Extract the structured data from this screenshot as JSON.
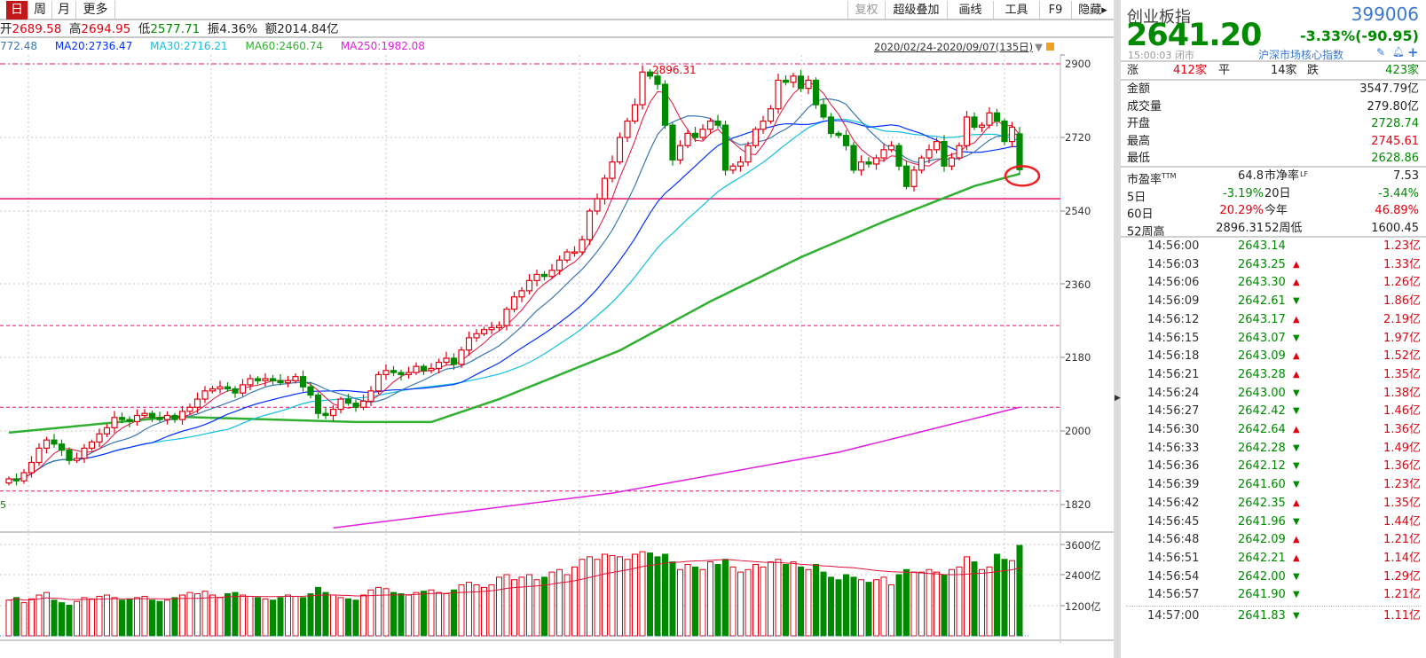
{
  "toolbar": {
    "tabs": [
      {
        "label": "日",
        "active": true
      },
      {
        "label": "周"
      },
      {
        "label": "月"
      },
      {
        "label": "更多"
      }
    ],
    "buttons": [
      "复权",
      "超级叠加",
      "画线",
      "工具",
      "F9",
      "隐藏▸"
    ]
  },
  "info": {
    "open_label": "开",
    "open": "2689.58",
    "high_label": "高",
    "high": "2694.95",
    "low_label": "低",
    "low": "2577.71",
    "amp_label": "振",
    "amp": "4.36%",
    "amount_label": "额",
    "amount": "2014.84亿"
  },
  "ma_legend": [
    {
      "text": "772.48",
      "color": "#3a78b0"
    },
    {
      "text": "MA20:2736.47",
      "color": "#0030ff"
    },
    {
      "text": "MA30:2716.21",
      "color": "#10c0e0"
    },
    {
      "text": "MA60:2460.74",
      "color": "#30b030"
    },
    {
      "text": "MA250:1982.08",
      "color": "#e020e0"
    }
  ],
  "date_range": "2020/02/24-2020/09/07(135日)",
  "left_edge_label": "5",
  "chart_data": {
    "type": "candlestick",
    "price_axis": {
      "ticks": [
        "2900",
        "2720",
        "2540",
        "2360",
        "2180",
        "2000",
        "1820"
      ],
      "range": [
        1770,
        2920
      ]
    },
    "volume_axis": {
      "ticks": [
        "3600亿",
        "2400亿",
        "1200亿"
      ],
      "range": [
        0,
        4000
      ]
    },
    "max_annotation": "2896.31",
    "closes": [
      1885,
      1880,
      1900,
      1925,
      1960,
      1980,
      1970,
      1955,
      1930,
      1935,
      1960,
      1975,
      1995,
      2010,
      2035,
      2030,
      2025,
      2040,
      2045,
      2035,
      2030,
      2040,
      2030,
      2050,
      2060,
      2080,
      2100,
      2105,
      2110,
      2105,
      2095,
      2115,
      2130,
      2125,
      2130,
      2125,
      2120,
      2125,
      2135,
      2110,
      2090,
      2045,
      2040,
      2055,
      2080,
      2070,
      2060,
      2075,
      2100,
      2140,
      2150,
      2145,
      2140,
      2145,
      2160,
      2150,
      2155,
      2170,
      2180,
      2165,
      2200,
      2230,
      2240,
      2250,
      2255,
      2260,
      2300,
      2330,
      2345,
      2370,
      2385,
      2380,
      2395,
      2420,
      2440,
      2440,
      2470,
      2540,
      2570,
      2620,
      2660,
      2720,
      2760,
      2800,
      2880,
      2870,
      2850,
      2750,
      2665,
      2700,
      2730,
      2720,
      2740,
      2760,
      2750,
      2640,
      2650,
      2660,
      2700,
      2740,
      2760,
      2790,
      2860,
      2855,
      2870,
      2840,
      2860,
      2800,
      2770,
      2730,
      2725,
      2700,
      2640,
      2660,
      2655,
      2670,
      2690,
      2700,
      2650,
      2600,
      2640,
      2670,
      2690,
      2710,
      2650,
      2670,
      2700,
      2770,
      2745,
      2750,
      2780,
      2760,
      2710,
      2745,
      2641.2
    ],
    "last_candle": {
      "open": 2728.74,
      "high": 2745.61,
      "low": 2628.86,
      "close": 2641.2
    },
    "volumes": [
      1400,
      1500,
      1300,
      1450,
      1600,
      1700,
      1400,
      1300,
      1200,
      1350,
      1500,
      1450,
      1550,
      1600,
      1500,
      1400,
      1450,
      1500,
      1550,
      1400,
      1350,
      1400,
      1500,
      1600,
      1700,
      1650,
      1750,
      1600,
      1500,
      1650,
      1700,
      1600,
      1550,
      1500,
      1450,
      1400,
      1500,
      1600,
      1550,
      1500,
      1650,
      1900,
      1700,
      1600,
      1500,
      1450,
      1400,
      1600,
      1800,
      1900,
      1850,
      1700,
      1650,
      1600,
      1700,
      1750,
      1800,
      1700,
      1650,
      1800,
      2000,
      2100,
      2000,
      1900,
      2000,
      2300,
      2400,
      2200,
      2300,
      2400,
      2200,
      2300,
      2500,
      2600,
      2400,
      2700,
      3000,
      3100,
      3000,
      3200,
      3150,
      3100,
      3000,
      3200,
      3300,
      3250,
      3100,
      3200,
      2900,
      2600,
      2800,
      2700,
      2600,
      2900,
      2800,
      3000,
      2700,
      2500,
      2600,
      2800,
      2700,
      2900,
      3000,
      2800,
      2900,
      2700,
      2600,
      2800,
      2500,
      2300,
      2200,
      2400,
      2300,
      2200,
      2100,
      2200,
      2300,
      2000,
      2400,
      2600,
      2500,
      2500,
      2600,
      2500,
      2400,
      2600,
      2700,
      3100,
      2900,
      2600,
      2700,
      3200,
      3000,
      2950,
      3547
    ],
    "ma60_path": [
      [
        0,
        1998
      ],
      [
        22,
        2037
      ],
      [
        46,
        2024
      ],
      [
        56,
        2024
      ],
      [
        65,
        2080
      ],
      [
        81,
        2199
      ],
      [
        93,
        2319
      ],
      [
        105,
        2427
      ],
      [
        116,
        2514
      ],
      [
        128,
        2601
      ],
      [
        134,
        2631
      ]
    ],
    "ma250_path": [
      [
        43,
        1765
      ],
      [
        80,
        1850
      ],
      [
        110,
        1950
      ],
      [
        134,
        2060
      ]
    ],
    "ref_lines": {
      "solid": 2570,
      "dashed": [
        2900,
        2260,
        2060,
        1855
      ]
    }
  },
  "quote": {
    "name": "创业板指",
    "code": "399006",
    "price": "2641.20",
    "change": "-3.33%(-90.95)",
    "time": "15:00:03",
    "status": "闭市",
    "category": "沪深市场核心指数",
    "breadth": {
      "up_label": "涨",
      "up": "412家",
      "flat_label": "平",
      "flat": "14家",
      "down_label": "跌",
      "down": "423家"
    },
    "stats": [
      {
        "label": "金额",
        "value": "3547.79亿",
        "cls": ""
      },
      {
        "label": "成交量",
        "value": "279.80亿",
        "cls": ""
      },
      {
        "label": "开盘",
        "value": "2728.74",
        "cls": "grn"
      },
      {
        "label": "最高",
        "value": "2745.61",
        "cls": "red"
      },
      {
        "label": "最低",
        "value": "2628.86",
        "cls": "grn"
      }
    ],
    "ratios": [
      {
        "l1": "市盈率",
        "s1": "TTM",
        "v1": "64.8",
        "c1": "",
        "l2": "市净率",
        "s2": "LF",
        "v2": "7.53",
        "c2": ""
      },
      {
        "l1": "5日",
        "s1": "",
        "v1": "-3.19%",
        "c1": "grn",
        "l2": "20日",
        "s2": "",
        "v2": "-3.44%",
        "c2": "grn"
      },
      {
        "l1": "60日",
        "s1": "",
        "v1": "20.29%",
        "c1": "red",
        "l2": "今年",
        "s2": "",
        "v2": "46.89%",
        "c2": "red"
      },
      {
        "l1": "52周高",
        "s1": "",
        "v1": "2896.31",
        "c1": "",
        "l2": "52周低",
        "s2": "",
        "v2": "1600.45",
        "c2": ""
      }
    ]
  },
  "ticks": [
    {
      "time": "14:56:00",
      "price": "2643.14",
      "dir": "",
      "vol": "1.23亿"
    },
    {
      "time": "14:56:03",
      "price": "2643.25",
      "dir": "up",
      "vol": "1.33亿"
    },
    {
      "time": "14:56:06",
      "price": "2643.30",
      "dir": "up",
      "vol": "1.26亿"
    },
    {
      "time": "14:56:09",
      "price": "2642.61",
      "dir": "down",
      "vol": "1.86亿"
    },
    {
      "time": "14:56:12",
      "price": "2643.17",
      "dir": "up",
      "vol": "2.19亿"
    },
    {
      "time": "14:56:15",
      "price": "2643.07",
      "dir": "down",
      "vol": "1.97亿"
    },
    {
      "time": "14:56:18",
      "price": "2643.09",
      "dir": "up",
      "vol": "1.52亿"
    },
    {
      "time": "14:56:21",
      "price": "2643.28",
      "dir": "up",
      "vol": "1.35亿"
    },
    {
      "time": "14:56:24",
      "price": "2643.00",
      "dir": "down",
      "vol": "1.38亿"
    },
    {
      "time": "14:56:27",
      "price": "2642.42",
      "dir": "down",
      "vol": "1.46亿"
    },
    {
      "time": "14:56:30",
      "price": "2642.64",
      "dir": "up",
      "vol": "1.36亿"
    },
    {
      "time": "14:56:33",
      "price": "2642.28",
      "dir": "down",
      "vol": "1.49亿"
    },
    {
      "time": "14:56:36",
      "price": "2642.12",
      "dir": "down",
      "vol": "1.36亿"
    },
    {
      "time": "14:56:39",
      "price": "2641.60",
      "dir": "down",
      "vol": "1.23亿"
    },
    {
      "time": "14:56:42",
      "price": "2642.35",
      "dir": "up",
      "vol": "1.35亿"
    },
    {
      "time": "14:56:45",
      "price": "2641.96",
      "dir": "down",
      "vol": "1.44亿"
    },
    {
      "time": "14:56:48",
      "price": "2642.09",
      "dir": "up",
      "vol": "1.21亿"
    },
    {
      "time": "14:56:51",
      "price": "2642.21",
      "dir": "up",
      "vol": "1.14亿"
    },
    {
      "time": "14:56:54",
      "price": "2642.00",
      "dir": "down",
      "vol": "1.29亿"
    },
    {
      "time": "14:56:57",
      "price": "2641.90",
      "dir": "down",
      "vol": "1.21亿"
    },
    {
      "time": "14:57:00",
      "price": "2641.83",
      "dir": "down",
      "vol": "1.11亿"
    }
  ],
  "colors": {
    "up": "#e00010",
    "down": "#008a00",
    "accent": "#c01818",
    "code": "#3a78d0"
  }
}
